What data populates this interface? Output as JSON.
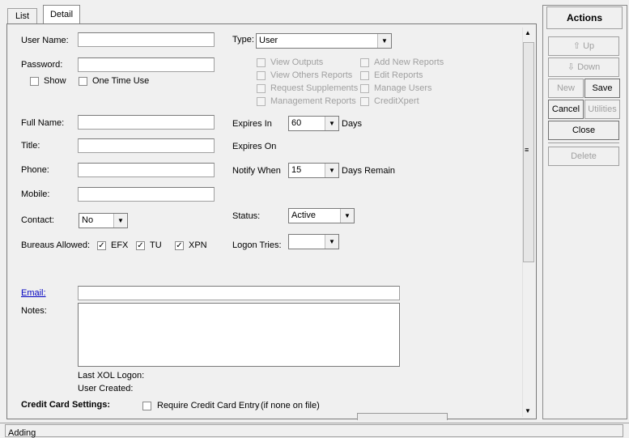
{
  "tabs": {
    "list": "List",
    "detail": "Detail"
  },
  "form": {
    "user_name_label": "User Name:",
    "password_label": "Password:",
    "show_label": "Show",
    "one_time_use_label": "One Time Use",
    "full_name_label": "Full Name:",
    "title_label": "Title:",
    "phone_label": "Phone:",
    "mobile_label": "Mobile:",
    "contact_label": "Contact:",
    "contact_value": "No",
    "bureaus_label": "Bureaus Allowed:",
    "bureaus": [
      {
        "label": "EFX",
        "checked": true
      },
      {
        "label": "TU",
        "checked": true
      },
      {
        "label": "XPN",
        "checked": true
      }
    ],
    "type_label": "Type:",
    "type_value": "User",
    "permissions_left": [
      "View Outputs",
      "View Others Reports",
      "Request Supplements",
      "Management Reports"
    ],
    "permissions_right": [
      "Add New Reports",
      "Edit Reports",
      "Manage Users",
      "CreditXpert"
    ],
    "expires_in_label": "Expires In",
    "expires_in_value": "60",
    "days_label": "Days",
    "expires_on_label": "Expires On",
    "notify_when_label": "Notify When",
    "notify_when_value": "15",
    "days_remain_label": "Days Remain",
    "status_label": "Status:",
    "status_value": "Active",
    "logon_tries_label": "Logon Tries:",
    "logon_tries_value": "",
    "email_label": "Email:",
    "notes_label": "Notes:",
    "last_logon_label": "Last XOL Logon:",
    "user_created_label": "User Created:",
    "cc_settings_label": "Credit Card Settings:",
    "require_cc_label": "Require Credit Card Entry",
    "require_cc_hint": "(if none on file)"
  },
  "actions": {
    "title": "Actions",
    "up": "Up",
    "down": "Down",
    "new": "New",
    "save": "Save",
    "cancel": "Cancel",
    "utilities": "Utilities",
    "close": "Close",
    "delete": "Delete"
  },
  "status_bar": {
    "text": "Adding"
  },
  "icons": {
    "up": "up-arrow-icon",
    "down": "down-arrow-icon",
    "dropdown": "chevron-down-icon"
  }
}
